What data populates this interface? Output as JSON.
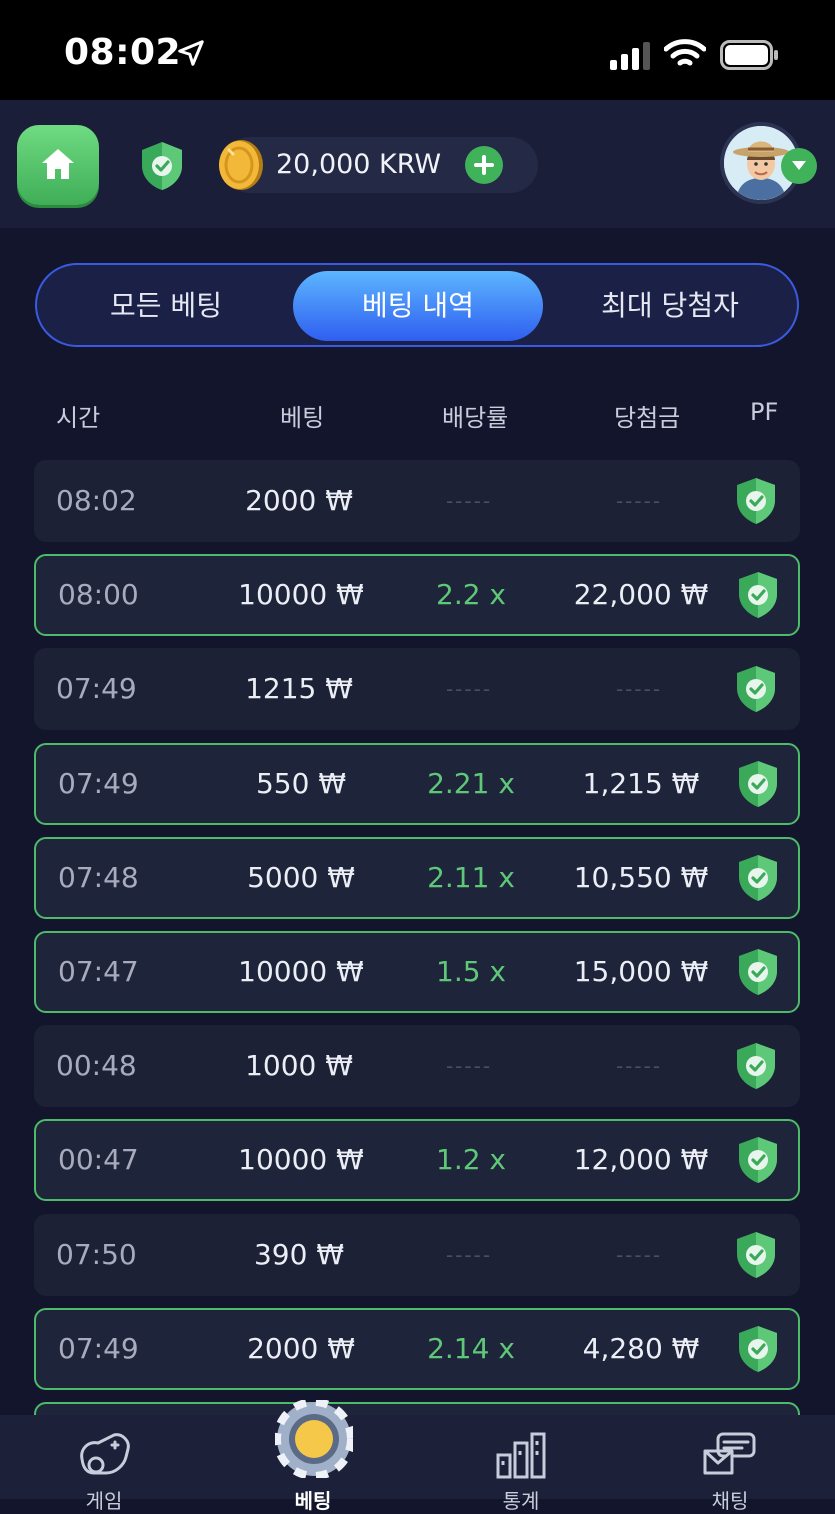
{
  "status_bar": {
    "time": "08:02"
  },
  "header": {
    "balance": "20,000 KRW"
  },
  "tabs": [
    {
      "label": "모든 베팅",
      "active": false
    },
    {
      "label": "베팅 내역",
      "active": true
    },
    {
      "label": "최대 당첨자",
      "active": false
    }
  ],
  "columns": {
    "time": "시간",
    "bet": "베팅",
    "multiplier": "배당률",
    "winnings": "당첨금",
    "pf": "PF"
  },
  "rows": [
    {
      "time": "08:02",
      "bet": "2000 ₩",
      "multiplier": "-----",
      "winnings": "-----",
      "won": false
    },
    {
      "time": "08:00",
      "bet": "10000 ₩",
      "multiplier": "2.2 x",
      "winnings": "22,000 ₩",
      "won": true
    },
    {
      "time": "07:49",
      "bet": "1215 ₩",
      "multiplier": "-----",
      "winnings": "-----",
      "won": false
    },
    {
      "time": "07:49",
      "bet": "550 ₩",
      "multiplier": "2.21 x",
      "winnings": "1,215 ₩",
      "won": true
    },
    {
      "time": "07:48",
      "bet": "5000 ₩",
      "multiplier": "2.11 x",
      "winnings": "10,550 ₩",
      "won": true
    },
    {
      "time": "07:47",
      "bet": "10000 ₩",
      "multiplier": "1.5 x",
      "winnings": "15,000 ₩",
      "won": true
    },
    {
      "time": "00:48",
      "bet": "1000 ₩",
      "multiplier": "-----",
      "winnings": "-----",
      "won": false
    },
    {
      "time": "00:47",
      "bet": "10000 ₩",
      "multiplier": "1.2 x",
      "winnings": "12,000 ₩",
      "won": true
    },
    {
      "time": "07:50",
      "bet": "390 ₩",
      "multiplier": "-----",
      "winnings": "-----",
      "won": false
    },
    {
      "time": "07:49",
      "bet": "2000 ₩",
      "multiplier": "2.14 x",
      "winnings": "4,280 ₩",
      "won": true
    }
  ],
  "bottom_nav": [
    {
      "label": "게임",
      "icon": "gamepad-icon",
      "active": false
    },
    {
      "label": "베팅",
      "icon": "chip-icon",
      "active": true
    },
    {
      "label": "통계",
      "icon": "stats-icon",
      "active": false
    },
    {
      "label": "채팅",
      "icon": "chat-icon",
      "active": false
    }
  ],
  "colors": {
    "background": "#12152b",
    "win_border": "#4dbb6a",
    "multiplier": "#5ec878",
    "tab_active": "#2f5ef0",
    "home_button": "#4fc466"
  }
}
